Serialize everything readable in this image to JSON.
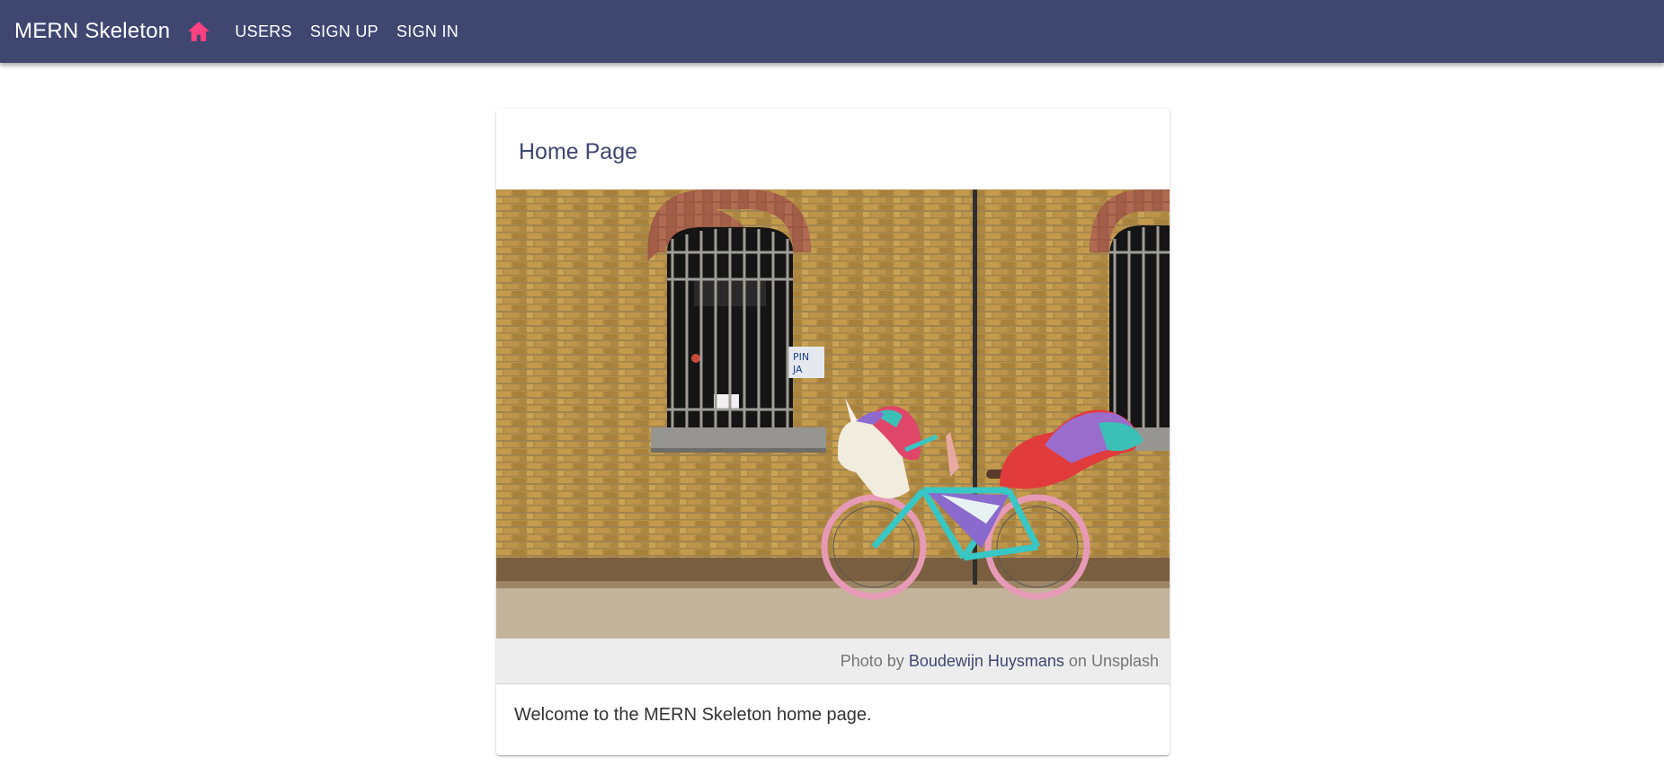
{
  "appbar": {
    "title": "MERN Skeleton",
    "nav": [
      {
        "label": "USERS"
      },
      {
        "label": "SIGN UP"
      },
      {
        "label": "SIGN IN"
      }
    ],
    "home_icon": "home-icon",
    "colors": {
      "appbar_bg": "#3f4771",
      "home_icon": "#ff4081"
    }
  },
  "card": {
    "title": "Home Page",
    "image_alt": "Unicorn bicycle",
    "caption": {
      "prefix": "Photo by",
      "author": "Boudewijn Huysmans",
      "suffix": "on Unsplash"
    },
    "body": "Welcome to the MERN Skeleton home page."
  }
}
